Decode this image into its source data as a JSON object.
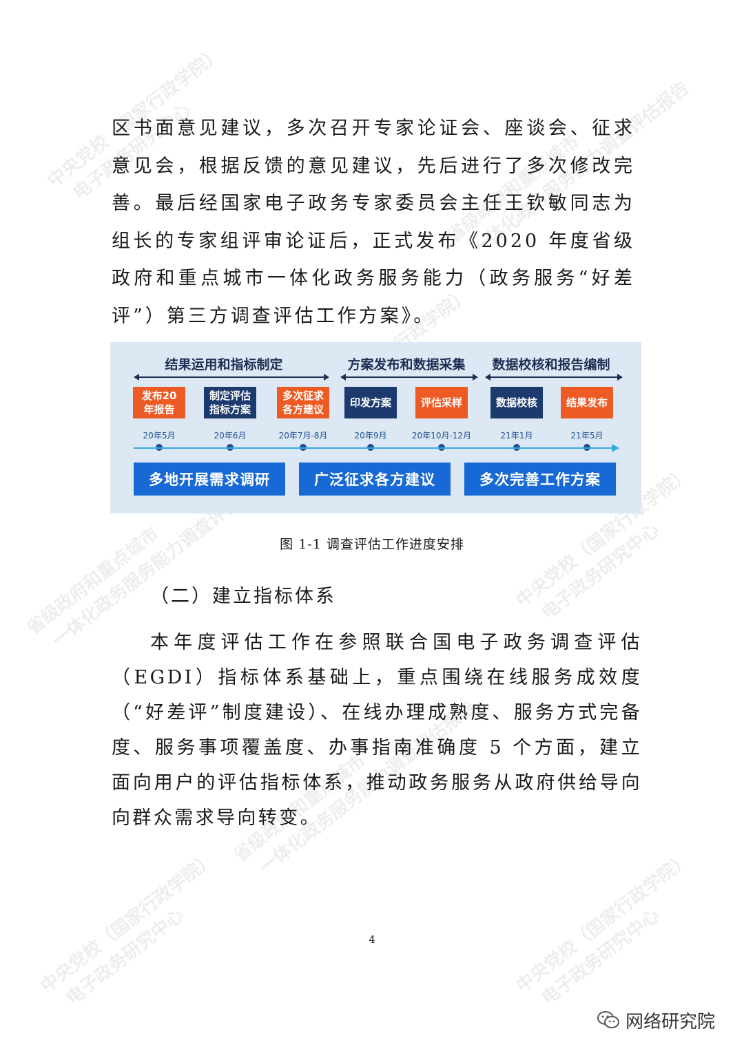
{
  "body": {
    "paragraph1": "区书面意见建议，多次召开专家论证会、座谈会、征求意见会，根据反馈的意见建议，先后进行了多次修改完善。最后经国家电子政务专家委员会主任王钦敏同志为组长的专家组评审论证后，正式发布《2020 年度省级政府和重点城市一体化政务服务能力（政务服务“好差评”）第三方调查评估工作方案》。",
    "figure_caption": "图 1-1  调查评估工作进度安排",
    "section_heading": "（二）建立指标体系",
    "paragraph2": "本年度评估工作在参照联合国电子政务调查评估（EGDI）指标体系基础上，重点围绕在线服务成效度（“好差评”制度建设）、在线办理成熟度、服务方式完备度、服务事项覆盖度、办事指南准确度 5 个方面，建立面向用户的评估指标体系，推动政务服务从政府供给导向向群众需求导向转变。",
    "page_number": "4"
  },
  "figure": {
    "phases": [
      "结果运用和指标制定",
      "方案发布和数据采集",
      "数据校核和报告编制"
    ],
    "steps": [
      {
        "label": "发布20\n年报告",
        "date": "20年5月",
        "color": "#ee5a24"
      },
      {
        "label": "制定评估\n指标方案",
        "date": "20年6月",
        "color": "#1d3a6e"
      },
      {
        "label": "多次征求\n各方建议",
        "date": "20年7月-8月",
        "color": "#ee5a24"
      },
      {
        "label": "印发方案",
        "date": "20年9月",
        "color": "#1d3a6e"
      },
      {
        "label": "评估采样",
        "date": "20年10月-12月",
        "color": "#ee5a24"
      },
      {
        "label": "数据校核",
        "date": "21年1月",
        "color": "#1d3a6e"
      },
      {
        "label": "结果发布",
        "date": "21年5月",
        "color": "#ee5a24"
      }
    ],
    "bottom_boxes": [
      "多地开展需求调研",
      "广泛征求各方建议",
      "多次完善工作方案"
    ],
    "colors": {
      "background": "#dce8f3",
      "orange": "#ee5a24",
      "navy": "#1d3a6e",
      "blue": "#1769d6",
      "timeline": "#3aa7e0"
    }
  },
  "watermarks": {
    "a_line1": "中央党校（国家行政学院）",
    "a_line2": "电子政务研究中心",
    "b_line1": "省级政府和重点城市",
    "b_line2": "一体化政务服务能力调查评估报告"
  },
  "footer": {
    "wechat_icon": "wechat-icon",
    "account_name": "网络研究院"
  }
}
